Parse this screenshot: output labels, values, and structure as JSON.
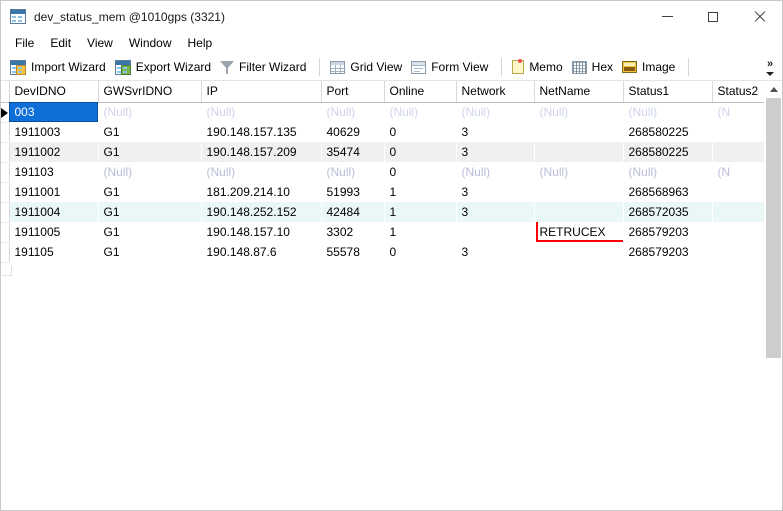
{
  "window": {
    "title": "dev_status_mem @1010gps (3321)",
    "icon": "table-window-icon",
    "controls": {
      "minimize": "minimize-button",
      "maximize": "maximize-button",
      "close": "close-button"
    }
  },
  "menubar": {
    "items": [
      "File",
      "Edit",
      "View",
      "Window",
      "Help"
    ]
  },
  "toolbar": {
    "groups": [
      [
        {
          "label": "Import Wizard",
          "icon": "import-wizard-icon"
        },
        {
          "label": "Export Wizard",
          "icon": "export-wizard-icon"
        },
        {
          "label": "Filter Wizard",
          "icon": "filter-funnel-icon"
        }
      ],
      [
        {
          "label": "Grid View",
          "icon": "grid-view-icon"
        },
        {
          "label": "Form View",
          "icon": "form-view-icon"
        }
      ],
      [
        {
          "label": "Memo",
          "icon": "memo-icon"
        },
        {
          "label": "Hex",
          "icon": "hex-icon"
        },
        {
          "label": "Image",
          "icon": "image-icon"
        }
      ]
    ],
    "overflow_chevron": "»"
  },
  "grid": {
    "columns": [
      {
        "name": "DevIDNO",
        "selected": true
      },
      {
        "name": "GWSvrIDNO",
        "selected": false
      },
      {
        "name": "IP",
        "selected": false
      },
      {
        "name": "Port",
        "selected": false
      },
      {
        "name": "Online",
        "selected": false
      },
      {
        "name": "Network",
        "selected": false
      },
      {
        "name": "NetName",
        "selected": false
      },
      {
        "name": "Status1",
        "selected": false
      },
      {
        "name": "Status2",
        "selected": false
      }
    ],
    "null_text": "(Null)",
    "rows": [
      {
        "band": "white",
        "current": true,
        "selected_cell": 0,
        "cells": [
          "003",
          "(Null)",
          "(Null)",
          "(Null)",
          "(Null)",
          "(Null)",
          "(Null)",
          "(Null)",
          "(N"
        ]
      },
      {
        "band": "white",
        "current": false,
        "selected_cell": -1,
        "cells": [
          "1911003",
          "G1",
          "190.148.157.135",
          "40629",
          "0",
          "3",
          "",
          "268580225",
          ""
        ]
      },
      {
        "band": "gray",
        "current": false,
        "selected_cell": -1,
        "cells": [
          "1911002",
          "G1",
          "190.148.157.209",
          "35474",
          "0",
          "3",
          "",
          "268580225",
          ""
        ]
      },
      {
        "band": "white",
        "current": false,
        "selected_cell": -1,
        "cells": [
          "191103",
          "(Null)",
          "(Null)",
          "(Null)",
          "0",
          "(Null)",
          "(Null)",
          "(Null)",
          "(N"
        ]
      },
      {
        "band": "white",
        "current": false,
        "selected_cell": -1,
        "cells": [
          "1911001",
          "G1",
          "181.209.214.10",
          "51993",
          "1",
          "3",
          "",
          "268568963",
          ""
        ]
      },
      {
        "band": "cyan",
        "current": false,
        "selected_cell": -1,
        "cells": [
          "1911004",
          "G1",
          "190.148.252.152",
          "42484",
          "1",
          "3",
          "",
          "268572035",
          ""
        ]
      },
      {
        "band": "white",
        "current": false,
        "selected_cell": -1,
        "annotated_cell": 6,
        "cells": [
          "1911005",
          "G1",
          "190.148.157.10",
          "3302",
          "1",
          "",
          "RETRUCEX",
          "268579203",
          ""
        ]
      },
      {
        "band": "white",
        "current": false,
        "selected_cell": -1,
        "cells": [
          "191105",
          "G1",
          "190.148.87.6",
          "55578",
          "0",
          "3",
          "",
          "268579203",
          ""
        ]
      }
    ]
  },
  "annotation": {
    "color": "#ff0000",
    "target_text": "RETRUCEX"
  },
  "scrollbar": {
    "up_arrow": "scroll-up-arrow",
    "thumb": "scroll-thumb"
  }
}
